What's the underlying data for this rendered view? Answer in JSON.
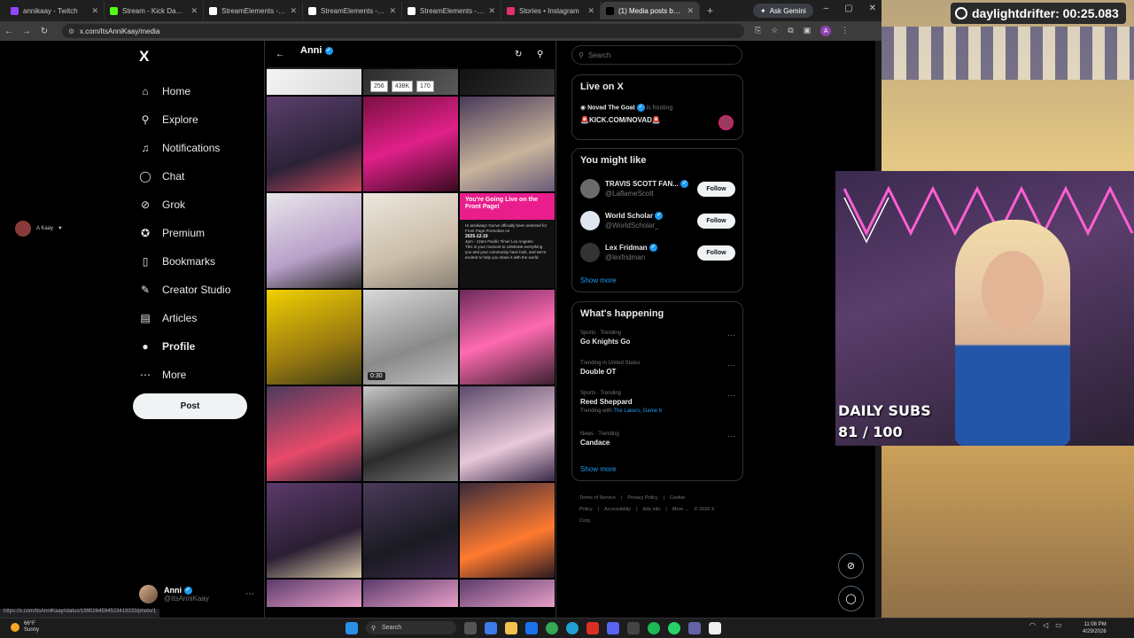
{
  "browser": {
    "tabs": [
      {
        "title": "annikaay - Twitch",
        "color": "#9146ff"
      },
      {
        "title": "Stream - Kick Dashboard",
        "color": "#53fc18"
      },
      {
        "title": "StreamElements - Overla",
        "color": "#ffffff"
      },
      {
        "title": "StreamElements - Overla",
        "color": "#ffffff"
      },
      {
        "title": "StreamElements - annika",
        "color": "#ffffff"
      },
      {
        "title": "Stories • Instagram",
        "color": "#e1306c"
      },
      {
        "title": "(1) Media posts by Anni",
        "color": "#000000",
        "active": true
      }
    ],
    "new_tab": "+",
    "ask_gemini": "Ask Gemini",
    "url": "x.com/ItsAnniKaay/media",
    "status_url": "https://x.com/ItsAnniKaay/status/1990264594523419333/photo/1"
  },
  "xnav": {
    "logo": "X",
    "items": [
      {
        "label": "Home",
        "icon": "home-icon",
        "glyph": "⌂"
      },
      {
        "label": "Explore",
        "icon": "search-icon",
        "glyph": "⚲"
      },
      {
        "label": "Notifications",
        "icon": "bell-icon",
        "glyph": "♫"
      },
      {
        "label": "Chat",
        "icon": "chat-icon",
        "glyph": "◯"
      },
      {
        "label": "Grok",
        "icon": "grok-icon",
        "glyph": "⊘"
      },
      {
        "label": "Premium",
        "icon": "premium-icon",
        "glyph": "✪"
      },
      {
        "label": "Bookmarks",
        "icon": "bookmark-icon",
        "glyph": "▯"
      },
      {
        "label": "Creator Studio",
        "icon": "creator-studio-icon",
        "glyph": "✎"
      },
      {
        "label": "Articles",
        "icon": "articles-icon",
        "glyph": "▤"
      },
      {
        "label": "Profile",
        "icon": "profile-icon",
        "glyph": "●"
      },
      {
        "label": "More",
        "icon": "more-icon",
        "glyph": "⋯"
      }
    ],
    "post_button": "Post",
    "account": {
      "name": "Anni",
      "handle": "@ItsAnniKaay"
    },
    "side_chip": "A Kaay"
  },
  "media": {
    "header_name": "Anni",
    "video_duration": "0:30",
    "tile_stats": [
      "256",
      "438K",
      "170"
    ],
    "promo": {
      "headline": "You're Going Live on the Front Page!",
      "body_1": "Hi annikaay! You've officially been selected for Front Page Promotion on",
      "date": "2025-12-19",
      "time": "4pm - 12am Pacific Time/ Los Angeles",
      "body_2": "This is your moment to celebrate everything you and your community have built, and we're excited to help you share it with the world."
    }
  },
  "right": {
    "search_placeholder": "Search",
    "live": {
      "title": "Live on X",
      "host_name": "Novad The Goat",
      "host_suffix": "is hosting",
      "link": "🚨KICK.COM/NOVAD🚨"
    },
    "like": {
      "title": "You might like",
      "people": [
        {
          "name": "TRAVIS SCOTT FAN...",
          "handle": "@LaflameScott"
        },
        {
          "name": "World Scholar",
          "handle": "@WorldScholar_"
        },
        {
          "name": "Lex Fridman",
          "handle": "@lexfridman"
        }
      ],
      "follow_label": "Follow",
      "show_more": "Show more"
    },
    "happening": {
      "title": "What's happening",
      "trends": [
        {
          "context": "Sports · Trending",
          "topic": "Go Knights Go"
        },
        {
          "context": "Trending in United States",
          "topic": "Double OT"
        },
        {
          "context": "Sports · Trending",
          "topic": "Reed Sheppard",
          "with_prefix": "Trending with",
          "with_link": "The Lakers, Game 6"
        },
        {
          "context": "News · Trending",
          "topic": "Candace"
        }
      ],
      "show_more": "Show more"
    },
    "footer": [
      "Terms of Service",
      "|",
      "Privacy Policy",
      "|",
      "Cookie Policy",
      "|",
      "Accessibility",
      "|",
      "Ads info",
      "|",
      "More ...",
      "© 2026 X Corp."
    ]
  },
  "overlay": {
    "timer": "daylightdrifter: 00:25.083",
    "subs_label": "DAILY SUBS",
    "subs_count": "81 / 100"
  },
  "taskbar": {
    "temp": "66°F",
    "condition": "Sunny",
    "search_placeholder": "Search",
    "time": "11:08 PM",
    "date": "4/29/2026"
  }
}
